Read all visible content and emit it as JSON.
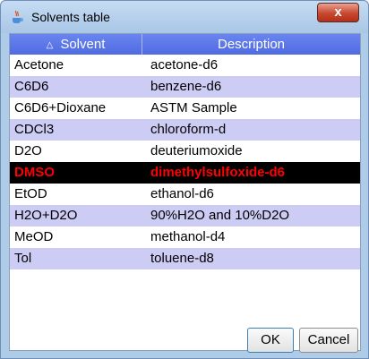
{
  "window": {
    "title": "Solvents table",
    "close_label": "x"
  },
  "table": {
    "columns": [
      {
        "label": "Solvent",
        "sort_indicator": "△"
      },
      {
        "label": "Description"
      }
    ],
    "rows": [
      {
        "solvent": "Acetone",
        "description": "acetone-d6"
      },
      {
        "solvent": "C6D6",
        "description": "benzene-d6"
      },
      {
        "solvent": "C6D6+Dioxane",
        "description": "ASTM Sample"
      },
      {
        "solvent": "CDCl3",
        "description": "chloroform-d"
      },
      {
        "solvent": "D2O",
        "description": "deuteriumoxide"
      },
      {
        "solvent": "DMSO",
        "description": "dimethylsulfoxide-d6"
      },
      {
        "solvent": "EtOD",
        "description": "ethanol-d6"
      },
      {
        "solvent": "H2O+D2O",
        "description": "90%H2O and 10%D2O"
      },
      {
        "solvent": "MeOD",
        "description": "methanol-d4"
      },
      {
        "solvent": "Tol",
        "description": "toluene-d8"
      }
    ],
    "selected_index": 5
  },
  "buttons": {
    "ok": "OK",
    "cancel": "Cancel"
  },
  "colors": {
    "header": "#5470e6",
    "alt_row": "#ccccf5",
    "selected_bg": "#000000",
    "selected_text": "#ff0000"
  },
  "icons": {
    "app": "java-cup-icon",
    "close": "close-icon"
  }
}
